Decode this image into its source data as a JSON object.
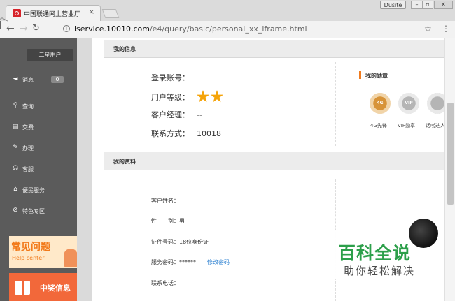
{
  "browser": {
    "tab_title": "中国联通网上营业厅",
    "tab_close": "×",
    "user_chip": "Dusite",
    "window_min": "–",
    "window_max": "▫",
    "window_close": "✕",
    "url_host": "iservice.10010.com",
    "url_path": "/e4/query/basic/personal_xx_iframe.html"
  },
  "sidebar": {
    "user_level_label": "二星用户",
    "items": [
      {
        "label": "消息",
        "icon": "speaker-icon",
        "badge": "0"
      },
      {
        "label": "查询",
        "icon": "search-icon"
      },
      {
        "label": "交费",
        "icon": "bill-icon"
      },
      {
        "label": "办理",
        "icon": "pen-icon"
      },
      {
        "label": "客服",
        "icon": "headset-icon"
      },
      {
        "label": "便民服务",
        "icon": "shop-icon"
      },
      {
        "label": "特色专区",
        "icon": "special-icon"
      }
    ],
    "banner_help": {
      "title": "常见问题",
      "subtitle": "Help center"
    },
    "banner_prize": {
      "title": "中奖信息"
    }
  },
  "main": {
    "my_info": {
      "title": "我的信息",
      "login_account_label": "登录账号：",
      "login_account_value": "",
      "user_level_label": "用户等级：",
      "user_level_stars": 2,
      "account_manager_label": "客户经理：",
      "account_manager_value": "--",
      "contact_label": "联系方式：",
      "contact_value": "10018"
    },
    "medals": {
      "title": "我的勋章",
      "items": [
        {
          "label": "4G先锋",
          "inner": "4G"
        },
        {
          "label": "VIP勋章",
          "inner": "VIP"
        },
        {
          "label": "话唠达人",
          "inner": ""
        }
      ]
    },
    "my_profile": {
      "title": "我的资料",
      "name_label": "客户姓名：",
      "name_value": "",
      "gender_label": "性　　别：",
      "gender_value": "男",
      "id_label": "证件号码：",
      "id_value": "18位身份证",
      "password_label": "服务密码：",
      "password_value": "******",
      "password_link": "修改密码",
      "phone_label": "联系电话：",
      "phone_value": ""
    }
  },
  "watermark": {
    "title": "百科全说",
    "subtitle": "助你轻松解决"
  },
  "colors": {
    "sidebar_bg": "#5b5b5b",
    "accent_orange": "#f07b1f",
    "star_gold": "#f5a40a",
    "link_blue": "#2a7fd0",
    "watermark_green": "#2c9f4a"
  }
}
